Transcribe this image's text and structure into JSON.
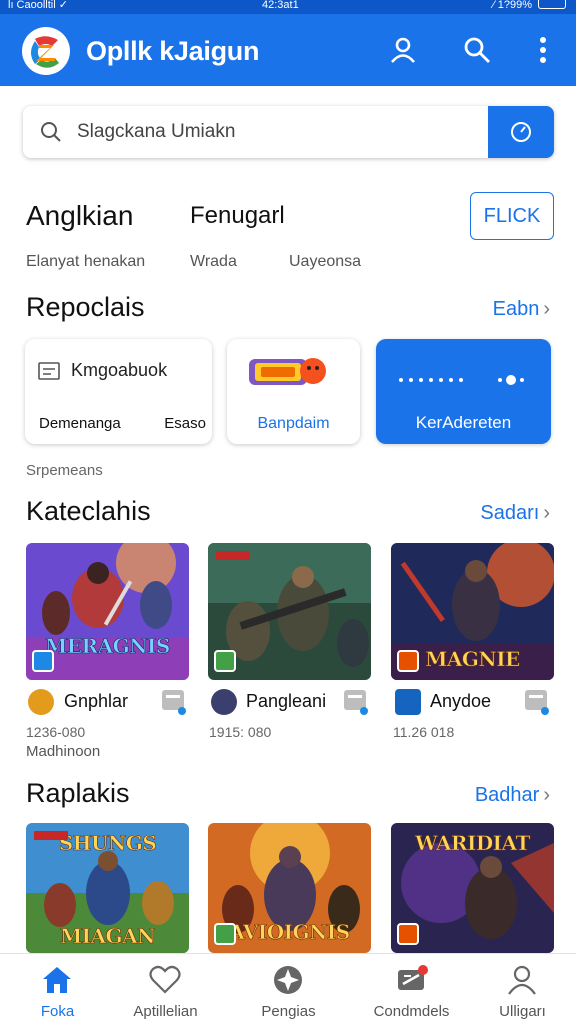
{
  "status_bar": {
    "left": "lı Caoolltil ✓",
    "center": "42:3at1",
    "right": "⁄ 1?99%"
  },
  "app": {
    "title": "Opllk kJaigun"
  },
  "search": {
    "placeholder": "Slagckana Umiakn"
  },
  "tabs": {
    "primary": "Anglkian",
    "secondary": "Fenugarl",
    "button": "FLICK"
  },
  "subtabs": [
    "Elanyat henakan",
    "Wrada",
    "Uayeonsa"
  ],
  "sections": {
    "categories": {
      "title": "Repoclais",
      "link": "Eabn"
    },
    "featured": {
      "title": "Kateclahis",
      "link": "Sadarı"
    },
    "more": {
      "title": "Raplakis",
      "link": "Badhar"
    }
  },
  "category_cards": [
    {
      "heading": "Kmgoabuok",
      "left": "Demenanga",
      "right": "Esaso"
    },
    {
      "label": "Banpdaim"
    },
    {
      "label": "KerAdereten"
    }
  ],
  "category_caption": "Srpemeans",
  "featured_games": [
    {
      "art_title": "MERAGNIS",
      "name": "Gnphlar",
      "stats": "1236-080",
      "sub": "Madhinoon",
      "icon_color": "#e39b1c",
      "badge_color": "#1e88e5"
    },
    {
      "art_title": "",
      "name": "Pangleani",
      "stats": "1915: 080",
      "sub": "",
      "icon_color": "#3b3f6e",
      "badge_color": "#43a047"
    },
    {
      "art_title": "MAGNIE",
      "name": "Anydoe",
      "stats": "11.26 018",
      "sub": "",
      "icon_color": "#1565c0",
      "badge_color": "#e65100"
    }
  ],
  "more_games": [
    {
      "art_title": "MIAGAN"
    },
    {
      "art_title": "AVIOIGNIS"
    },
    {
      "art_title": "WARIDIAT"
    }
  ],
  "bottom_nav": [
    {
      "label": "Foka",
      "icon": "home-icon",
      "active": true
    },
    {
      "label": "Aptillelian",
      "icon": "heart-icon",
      "active": false
    },
    {
      "label": "Pengias",
      "icon": "compass-icon",
      "active": false
    },
    {
      "label": "Condmdels",
      "icon": "ticket-icon",
      "active": false
    },
    {
      "label": "Ulligarı",
      "icon": "user-icon",
      "active": false
    }
  ],
  "colors": {
    "accent": "#1a73e8",
    "appbar": "#1a73e8",
    "statusbar": "#0d57c8",
    "notification": "#e53935"
  }
}
